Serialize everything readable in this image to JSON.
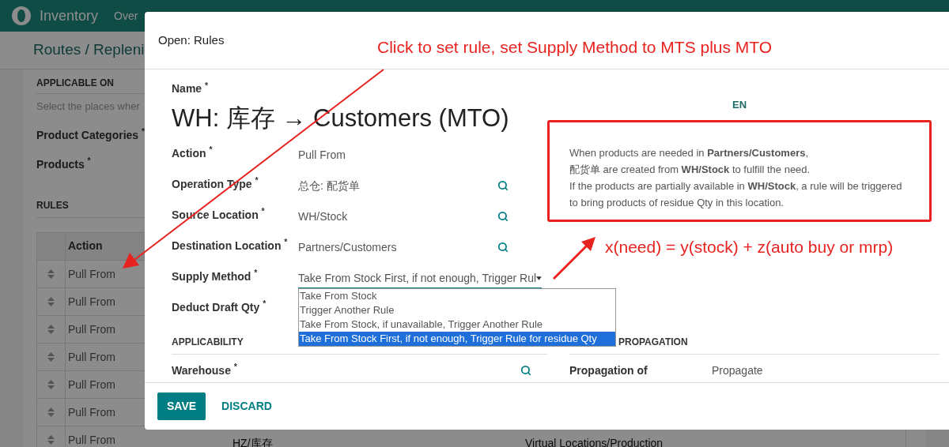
{
  "app_bar": {
    "app_name": "Inventory",
    "menu_items": [
      "Over"
    ]
  },
  "breadcrumb": "Routes / Repleni",
  "background_form": {
    "section_applicable": "APPLICABLE ON",
    "hint": "Select the places wher",
    "fields": [
      "Product Categories $^{*}$",
      "Products $^{*}$"
    ],
    "section_rules": "RULES",
    "table": {
      "columns": [
        "Action"
      ],
      "rows": [
        {
          "action": "Pull From"
        },
        {
          "action": "Pull From"
        },
        {
          "action": "Pull From"
        },
        {
          "action": "Pull From"
        },
        {
          "action": "Pull From"
        },
        {
          "action": "Pull From"
        },
        {
          "action": "Pull From",
          "column_2": "HZ/库存",
          "column_3": "Virtual Locations/Production"
        }
      ]
    }
  },
  "dialog": {
    "title": "Open: Rules",
    "name_label": "Name $^{*}$",
    "name_value": "WH: 库存 → Customers (MTO)",
    "language": "EN",
    "fields": [
      {
        "kind": "text",
        "label": "Action $^{*}$",
        "value": "Pull From"
      },
      {
        "kind": "many2one",
        "label": "Operation Type $^{*}$",
        "value": "总仓: 配货单"
      },
      {
        "kind": "many2one",
        "label": "Source Location $^{*}$",
        "value": "WH/Stock"
      },
      {
        "kind": "many2one",
        "label": "Destination Location $^{*}$",
        "value": "Partners/Customers"
      },
      {
        "kind": "select",
        "label": "Supply Method $^{*}$",
        "value": "Take From Stock First, if not enough, Trigger Rul",
        "expanded": true,
        "options": [
          {
            "label": "Take From Stock",
            "selected": false
          },
          {
            "label": "Trigger Another Rule",
            "selected": false
          },
          {
            "label": "Take From Stock, if unavailable, Trigger Another Rule",
            "selected": false
          },
          {
            "label": "Take From Stock First, if not enough, Trigger Rule for residue Qty",
            "selected": true
          }
        ]
      },
      {
        "kind": "empty",
        "label": "Deduct Draft Qty $^{*}$"
      }
    ],
    "description": [
      "When products are needed in **Partners/Customers**,",
      "配货单 are created from **WH/Stock** to fulfill the need.",
      "If the products are partially available in **WH/Stock**, a rule will be triggered",
      "to bring products of residue Qty in this location."
    ],
    "section_applicability": "APPLICABILITY",
    "section_propagation": "PROPAGATION",
    "warehouse_label": "Warehouse $^{*}$",
    "propagation_label": "Propagation of",
    "propagation_value": "Propagate",
    "buttons": [
      "SAVE",
      "DISCARD"
    ]
  },
  "annotations": {
    "instruction": "Click to set rule, set Supply Method to MTS plus MTO",
    "formula": "x(need) = y(stock) + z(auto buy or mrp)"
  }
}
